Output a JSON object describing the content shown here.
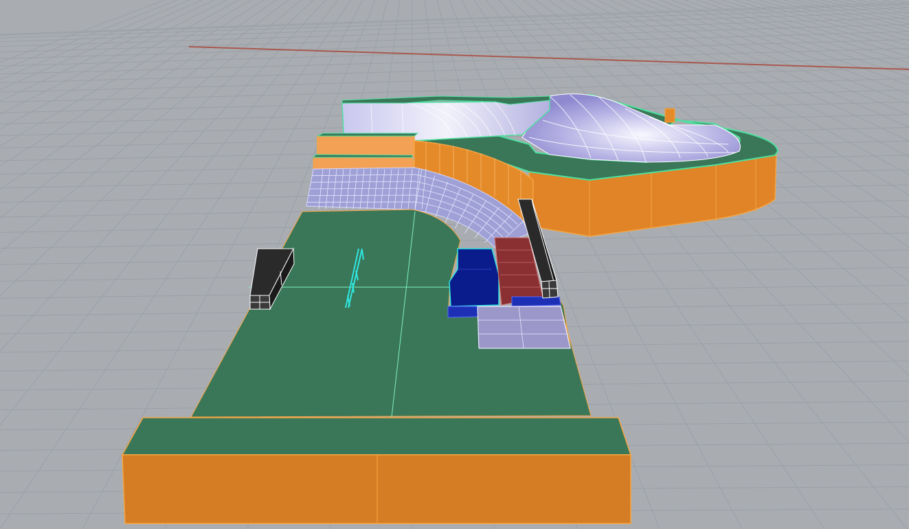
{
  "viewport": {
    "kind": "3d-perspective-viewport",
    "background_color": "#a9adb2",
    "grid_color": "#9ba0a6",
    "axis_x_color": "#a9584f",
    "selected_surface_color": "#e58a28",
    "selected_edge_color": "#f5a542",
    "floor_surface_color": "#3a7758",
    "edge_highlight_color": "#4de0a0",
    "ramp_surface_color": "#c8c8ea",
    "rail_color": "#2fe6e0",
    "box_blue_color": "#0a1c8c",
    "box_red_color": "#8a3032",
    "ledge_black_color": "#222222"
  },
  "objects": [
    {
      "name": "skatepark-floor",
      "kind": "planar-surface"
    },
    {
      "name": "front-platform",
      "kind": "extrusion"
    },
    {
      "name": "bowl",
      "kind": "polysurface"
    },
    {
      "name": "quarter-pipe",
      "kind": "polysurface"
    },
    {
      "name": "back-deck",
      "kind": "extrusion"
    },
    {
      "name": "left-ledge",
      "kind": "box"
    },
    {
      "name": "right-ledge",
      "kind": "box"
    },
    {
      "name": "flat-rail",
      "kind": "curve"
    },
    {
      "name": "blue-box",
      "kind": "polysurface"
    },
    {
      "name": "red-box",
      "kind": "polysurface"
    },
    {
      "name": "manual-pad",
      "kind": "planar-surface"
    }
  ]
}
